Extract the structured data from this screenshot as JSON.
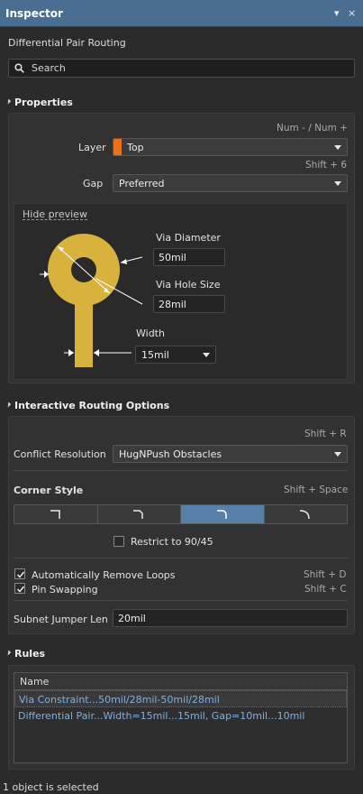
{
  "window": {
    "title": "Inspector",
    "pin_glyph": "▾",
    "close_glyph": "×"
  },
  "subtitle": "Differential Pair Routing",
  "search": {
    "placeholder": "Search",
    "icon": "search-icon"
  },
  "properties": {
    "header": "Properties",
    "layer_hint": "Num - / Num +",
    "layer_label": "Layer",
    "layer_value": "Top",
    "layer_color": "#e8731a",
    "gap_hint": "Shift + 6",
    "gap_label": "Gap",
    "gap_value": "Preferred",
    "preview": {
      "hide_link": "Hide preview",
      "via_diameter_label": "Via Diameter",
      "via_diameter_value": "50mil",
      "via_hole_label": "Via Hole Size",
      "via_hole_value": "28mil",
      "width_label": "Width",
      "width_value": "15mil",
      "via_color": "#d8b23c"
    }
  },
  "routing": {
    "header": "Interactive Routing Options",
    "conflict_hint": "Shift + R",
    "conflict_label": "Conflict Resolution",
    "conflict_value": "HugNPush Obstacles",
    "corner_label": "Corner Style",
    "corner_hint": "Shift + Space",
    "corner_options": [
      "90 degree",
      "45 degree",
      "45 degree with arc",
      "90 degree with arc"
    ],
    "corner_selected": 2,
    "restrict_label": "Restrict to 90/45",
    "restrict_checked": false,
    "remove_loops_label": "Automatically Remove Loops",
    "remove_loops_hint": "Shift + D",
    "remove_loops_checked": true,
    "pin_swap_label": "Pin Swapping",
    "pin_swap_hint": "Shift + C",
    "pin_swap_checked": true,
    "subnet_label": "Subnet Jumper Len",
    "subnet_value": "20mil"
  },
  "rules": {
    "header": "Rules",
    "column": "Name",
    "rows": [
      "Via Constraint...50mil/28mil-50mil/28mil",
      "Differential Pair...Width=15mil...15mil, Gap=10mil...10mil"
    ]
  },
  "status": "1 object is selected"
}
